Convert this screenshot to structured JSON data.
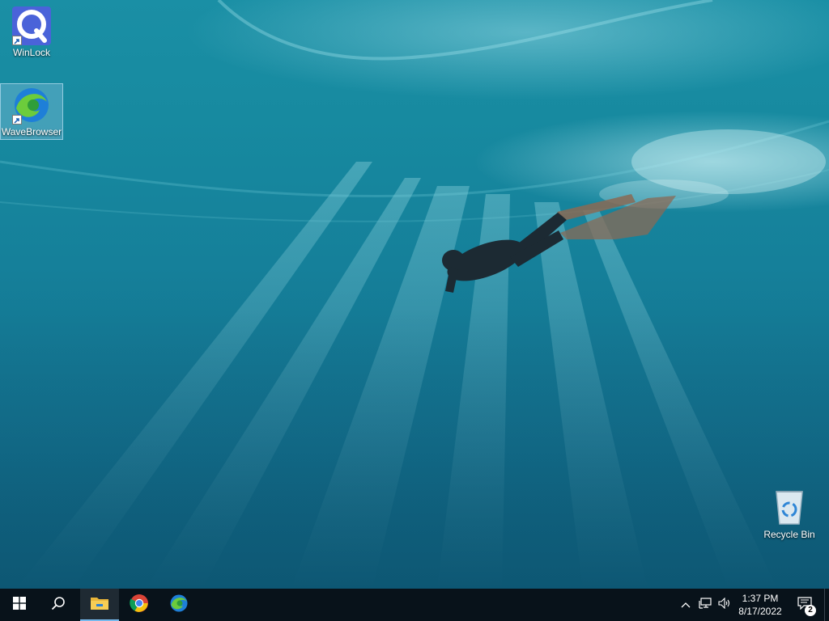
{
  "desktop": {
    "wallpaper": "underwater-freediver",
    "icons": [
      {
        "label": "WinLock",
        "icon": "winlock-icon",
        "shortcut": true
      },
      {
        "label": "WaveBrowser",
        "icon": "wavebrowser-icon",
        "shortcut": true,
        "selected": true
      },
      {
        "label": "Recycle Bin",
        "icon": "recycle-bin-icon",
        "shortcut": false
      }
    ]
  },
  "taskbar": {
    "start_icon": "windows-logo-icon",
    "search_icon": "search-icon",
    "pinned": [
      {
        "name": "File Explorer",
        "icon": "file-explorer-icon",
        "active": true
      },
      {
        "name": "Google Chrome",
        "icon": "chrome-icon",
        "active": false
      },
      {
        "name": "WaveBrowser",
        "icon": "wavebrowser-icon",
        "active": false
      }
    ],
    "tray": {
      "chevron_icon": "chevron-up-icon",
      "network_icon": "network-icon",
      "volume_icon": "volume-icon",
      "time": "1:37 PM",
      "date": "8/17/2022",
      "notification_icon": "notification-center-icon",
      "notification_count": "2"
    }
  },
  "colors": {
    "taskbar_bg": "#08121a",
    "accent": "#76b9ed",
    "water_top": "#1a8fa5",
    "water_bottom": "#0f5e7a"
  }
}
